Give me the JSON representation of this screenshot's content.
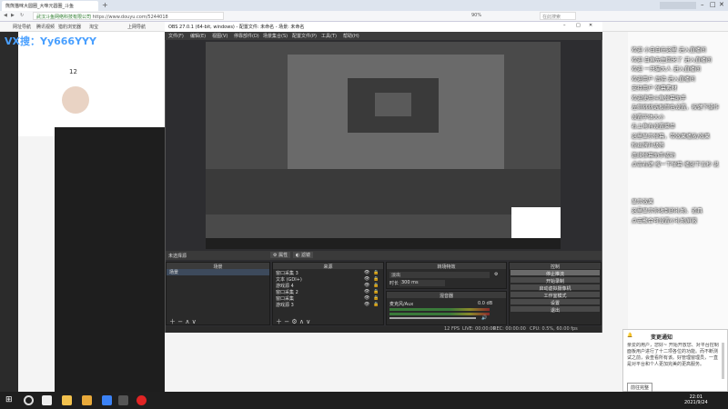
{
  "browser": {
    "tab_active": "熊熊猫咪大圆圈_大咪元圆圈_斗鱼",
    "url_org": "武汉斗鱼网络科技有限公司",
    "url": "https://www.douyu.com/5244018",
    "zoom": "90%",
    "search_hint": "在此搜索",
    "bookmarks": [
      "网址导航",
      "腾讯视频",
      "猎豹浏览器",
      "淘宝",
      "上网导航"
    ]
  },
  "watermark": "VX搜：Yy666YYY",
  "obs": {
    "title": "OBS 27.0.1 (64-bit, windows) - 配置文件: 未命名 - 场景: 未命名",
    "menu": [
      "文件(F)",
      "编辑(E)",
      "视图(V)",
      "停靠部件(D)",
      "场景集合(S)",
      "配置文件(P)",
      "工具(T)",
      "帮助(H)"
    ],
    "no_source": "未选择源",
    "props_label": "属性",
    "filter_label": "滤镜",
    "panels": {
      "scenes": {
        "title": "场景",
        "items": [
          "场景"
        ]
      },
      "sources": {
        "title": "来源",
        "items": [
          "窗口采集 3",
          "文本 (GDI+)",
          "游戏源 4",
          "窗口采集 2",
          "窗口采集",
          "游戏源 3"
        ]
      },
      "transitions": {
        "title": "转场特效",
        "type": "淡出",
        "duration_label": "时长",
        "duration": "300 ms"
      },
      "mixer": {
        "title": "混音器",
        "track": "麦克风/Aux",
        "level": "0.0 dB"
      },
      "controls": {
        "title": "控制",
        "buttons": [
          "停止推流",
          "开始录制",
          "启动虚拟摄像机",
          "工作室模式",
          "设置",
          "退出"
        ]
      }
    },
    "status": {
      "fps": "12 FPS",
      "live": "LIVE: 00:00:00",
      "rec": "REC: 00:00:00",
      "cpu": "CPU: 0.5%, 60.00 fps"
    }
  },
  "chat": [
    "欢迎 小白白在这里 进入直播间",
    "欢迎 白鱼先生回来了 进入直播间",
    "欢迎 一只猫大人 进入直播间",
    "欢迎用户 后佛 进入直播间",
    "支持用户 弹幕素材",
    "欢迎使用斗鱼弹幕助手",
    "左侧挑挑选板颜色设置，按键下操作",
    "设置字体大小",
    "右上角有设置菜单",
    "这里显示弹幕，带效果播放/效果",
    "粉丝牌升级等",
    "连续弹幕助手成功",
    "点击右键 搜一下弹幕  播放下五秒 说",
    "显示效果",
    "这里显示你收到的礼物、道具",
    "点击聚合可设置小礼物屏蔽"
  ],
  "notification": {
    "title": "变更通知",
    "body": "亲爱的用户，您好~ 开始开放您、对平台控制面板用户进行了十二项各位的功能。而不断测试之前，会查看所有该。好管理窗理员，一直是对平台和个人更加完美的更高服务。",
    "link": "前往完整"
  },
  "taskbar": {
    "time": "22:01",
    "date": "2021/9/24"
  },
  "colors": {
    "obs_bg": "#2d2d30",
    "browser_tab": "#dde4ee",
    "taskbar": "#1f1f1f",
    "douyu_orange": "#ff7a00"
  }
}
